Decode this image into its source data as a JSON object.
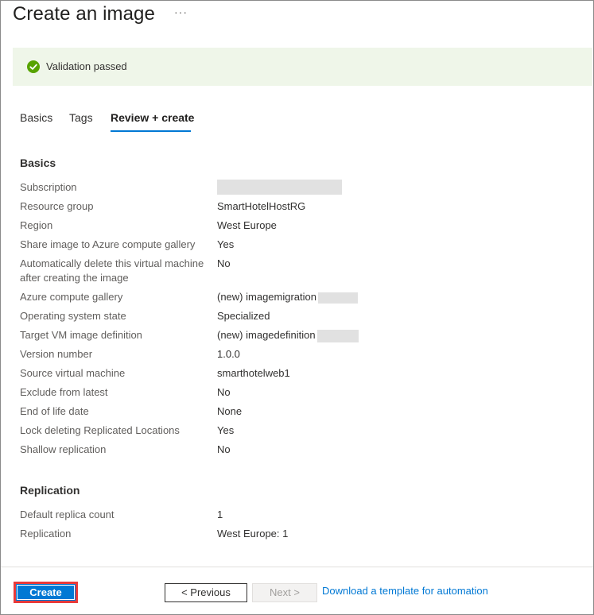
{
  "header": {
    "title": "Create an image",
    "more_label": "···"
  },
  "validation": {
    "text": "Validation passed",
    "color": "#57a300"
  },
  "tabs": [
    {
      "label": "Basics",
      "active": false
    },
    {
      "label": "Tags",
      "active": false
    },
    {
      "label": "Review + create",
      "active": true
    }
  ],
  "basics": {
    "title": "Basics",
    "rows": [
      {
        "label": "Subscription",
        "value": ""
      },
      {
        "label": "Resource group",
        "value": "SmartHotelHostRG"
      },
      {
        "label": "Region",
        "value": "West Europe"
      },
      {
        "label": "Share image to Azure compute gallery",
        "value": "Yes"
      },
      {
        "label": "Automatically delete this virtual machine",
        "label2": "after creating the image",
        "value": "No"
      },
      {
        "label": "Azure compute gallery",
        "value": "(new) imagemigration"
      },
      {
        "label": "Operating system state",
        "value": "Specialized"
      },
      {
        "label": "Target VM image definition",
        "value": "(new) imagedefinition"
      },
      {
        "label": "Version number",
        "value": "1.0.0"
      },
      {
        "label": "Source virtual machine",
        "value": "smarthotelweb1"
      },
      {
        "label": "Exclude from latest",
        "value": "No"
      },
      {
        "label": "End of life date",
        "value": "None"
      },
      {
        "label": "Lock deleting Replicated Locations",
        "value": "Yes"
      },
      {
        "label": "Shallow replication",
        "value": "No"
      }
    ]
  },
  "replication": {
    "title": "Replication",
    "rows": [
      {
        "label": "Default replica count",
        "value": "1"
      },
      {
        "label": "Replication",
        "value": "West Europe: 1"
      }
    ]
  },
  "footer": {
    "create_label": "Create",
    "previous_label": "< Previous",
    "next_label": "Next >",
    "template_link": "Download a template for automation"
  }
}
